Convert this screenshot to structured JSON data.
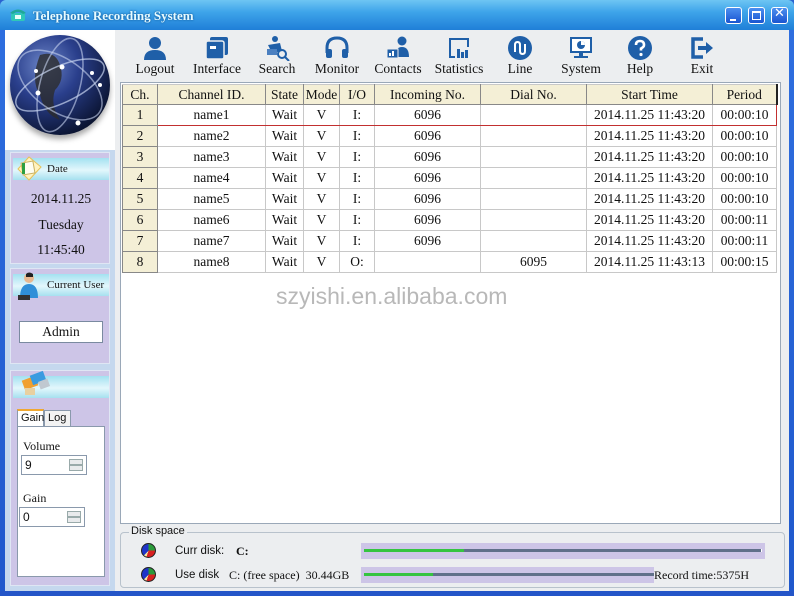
{
  "window": {
    "title": "Telephone Recording System",
    "controls": {
      "minimize": "minimize",
      "maximize": "maximize",
      "close": "✕"
    }
  },
  "toolbar": [
    {
      "label": "Logout",
      "icon": "user-icon"
    },
    {
      "label": "Interface",
      "icon": "interface-icon"
    },
    {
      "label": "Search",
      "icon": "search-user-icon"
    },
    {
      "label": "Monitor",
      "icon": "headphones-icon"
    },
    {
      "label": "Contacts",
      "icon": "contacts-icon"
    },
    {
      "label": "Statistics",
      "icon": "statistics-icon"
    },
    {
      "label": "Line",
      "icon": "line-icon"
    },
    {
      "label": "System",
      "icon": "monitor-pie-icon"
    },
    {
      "label": "Help",
      "icon": "help-icon"
    },
    {
      "label": "Exit",
      "icon": "exit-icon"
    }
  ],
  "sidebar": {
    "date": {
      "header": "Date",
      "date": "2014.11.25",
      "weekday": "Tuesday",
      "time": "11:45:40"
    },
    "user": {
      "header": "Current User",
      "name": "Admin"
    },
    "tabs": [
      {
        "label": "Gain",
        "active": true
      },
      {
        "label": "Log",
        "active": false
      }
    ],
    "volume": {
      "label": "Volume",
      "value": "9"
    },
    "gain": {
      "label": "Gain",
      "value": "0"
    }
  },
  "table": {
    "columns": [
      "Ch.",
      "Channel ID.",
      "State",
      "Mode",
      "I/O",
      "Incoming No.",
      "Dial No.",
      "Start Time",
      "Period"
    ],
    "selected_row": 0,
    "rows": [
      [
        "1",
        "name1",
        "Wait",
        "V",
        "I:",
        "6096",
        "",
        "2014.11.25 11:43:20",
        "00:00:10"
      ],
      [
        "2",
        "name2",
        "Wait",
        "V",
        "I:",
        "6096",
        "",
        "2014.11.25 11:43:20",
        "00:00:10"
      ],
      [
        "3",
        "name3",
        "Wait",
        "V",
        "I:",
        "6096",
        "",
        "2014.11.25 11:43:20",
        "00:00:10"
      ],
      [
        "4",
        "name4",
        "Wait",
        "V",
        "I:",
        "6096",
        "",
        "2014.11.25 11:43:20",
        "00:00:10"
      ],
      [
        "5",
        "name5",
        "Wait",
        "V",
        "I:",
        "6096",
        "",
        "2014.11.25 11:43:20",
        "00:00:10"
      ],
      [
        "6",
        "name6",
        "Wait",
        "V",
        "I:",
        "6096",
        "",
        "2014.11.25 11:43:20",
        "00:00:11"
      ],
      [
        "7",
        "name7",
        "Wait",
        "V",
        "I:",
        "6096",
        "",
        "2014.11.25 11:43:20",
        "00:00:11"
      ],
      [
        "8",
        "name8",
        "Wait",
        "V",
        "O:",
        "",
        "6095",
        "2014.11.25 11:43:13",
        "00:00:15"
      ]
    ]
  },
  "watermark": "szyishi.en.alibaba.com",
  "disk": {
    "legend": "Disk space",
    "curr": {
      "label": "Curr disk:",
      "value": "C:",
      "usage_fraction": 0.25
    },
    "use": {
      "label": "Use disk",
      "value": "C: (free space)  30.44GB",
      "usage_fraction": 0.24
    },
    "record_time": "Record time:5375H"
  },
  "colors": {
    "accent": "#1f5fa8",
    "progress": "#35c440",
    "selected_border": "#c23030",
    "header_bg": "#f4efd6"
  }
}
